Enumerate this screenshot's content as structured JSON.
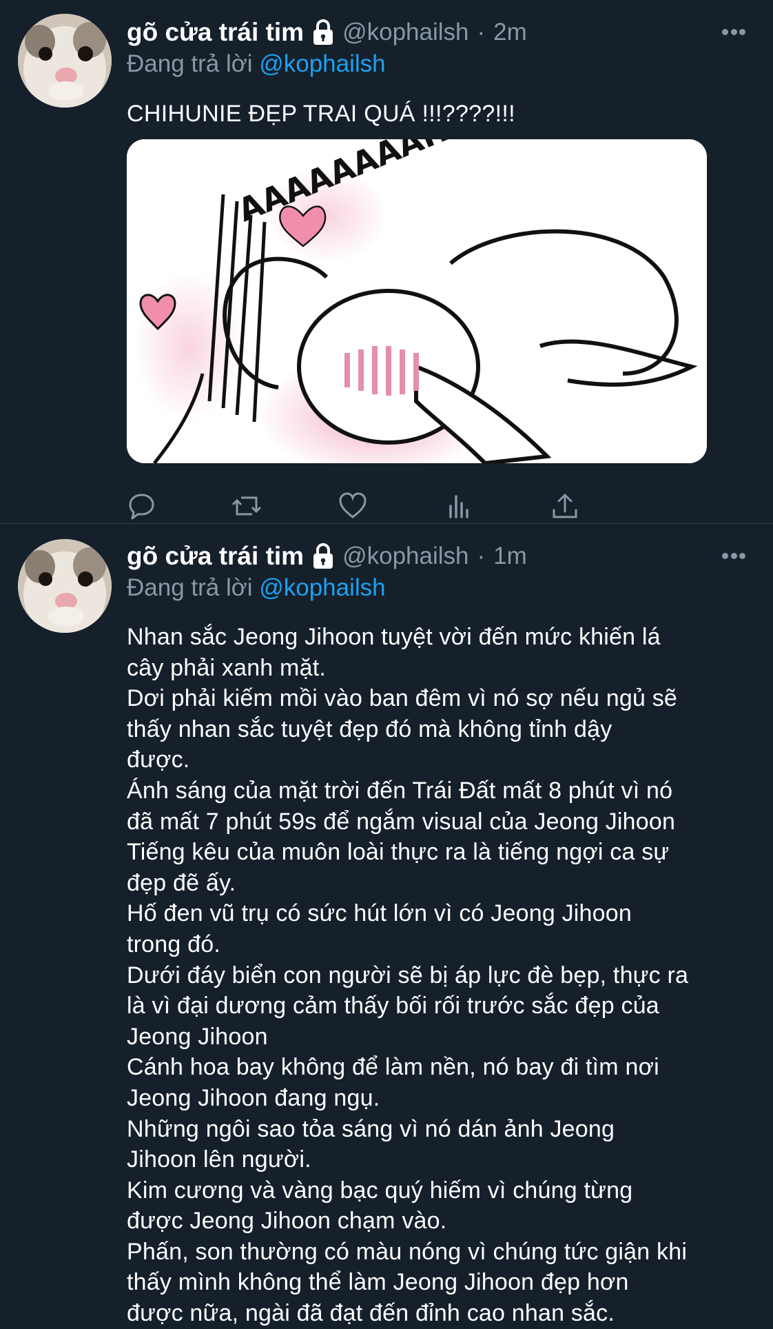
{
  "tweets": [
    {
      "name": "gõ cửa trái tim",
      "handle": "@kophailsh",
      "separator": "·",
      "time": "2m",
      "replying_prefix": "Đang trả lời",
      "replying_to": "@kophailsh",
      "text": "CHIHUNIE ĐẸP TRAI QUÁ !!!????!!!",
      "media_caption": "AAAAAAAAHHHHHHHH"
    },
    {
      "name": "gõ cửa trái tim",
      "handle": "@kophailsh",
      "separator": "·",
      "time": "1m",
      "replying_prefix": "Đang trả lời",
      "replying_to": "@kophailsh",
      "lines": [
        "Nhan sắc Jeong Jihoon tuyệt vời đến mức khiến lá",
        "cây phải xanh mặt.",
        "Dơi phải kiếm mồi vào ban đêm vì nó sợ nếu ngủ sẽ",
        "thấy nhan sắc tuyệt đẹp đó mà không tỉnh dậy",
        "được.",
        "Ánh sáng của mặt trời đến Trái Đất mất 8 phút vì nó",
        "đã mất 7 phút 59s để ngắm visual của Jeong Jihoon",
        "Tiếng kêu của muôn loài thực ra là tiếng ngợi ca sự",
        "đẹp đẽ ấy.",
        "Hố đen vũ trụ có sức hút lớn vì có Jeong Jihoon",
        "trong đó.",
        "Dưới đáy biển con người sẽ bị áp lực đè bẹp, thực ra",
        "là vì đại dương cảm thấy bối rối trước sắc đẹp của",
        "Jeong Jihoon",
        "Cánh hoa bay không để làm nền, nó bay đi tìm nơi",
        "Jeong Jihoon đang ngụ.",
        "Những ngôi sao tỏa sáng vì nó dán ảnh  Jeong",
        "Jihoon lên người.",
        "Kim cương và vàng bạc quý hiếm vì chúng từng",
        "được  Jeong Jihoon chạm vào.",
        "Phấn, son thường có màu nóng vì chúng tức giận khi",
        "thấy mình không thể làm  Jeong Jihoon đẹp hơn",
        "được nữa, ngài đã đạt đến đỉnh cao nhan sắc."
      ]
    }
  ],
  "icons": {
    "reply": "reply-icon",
    "retweet": "retweet-icon",
    "like": "heart-icon",
    "analytics": "analytics-icon",
    "share": "share-icon",
    "lock": "lock-icon",
    "more": "more-icon"
  },
  "colors": {
    "background": "#15202b",
    "secondary_text": "#8899a6",
    "link": "#1da1f2",
    "divider": "#38444d"
  }
}
